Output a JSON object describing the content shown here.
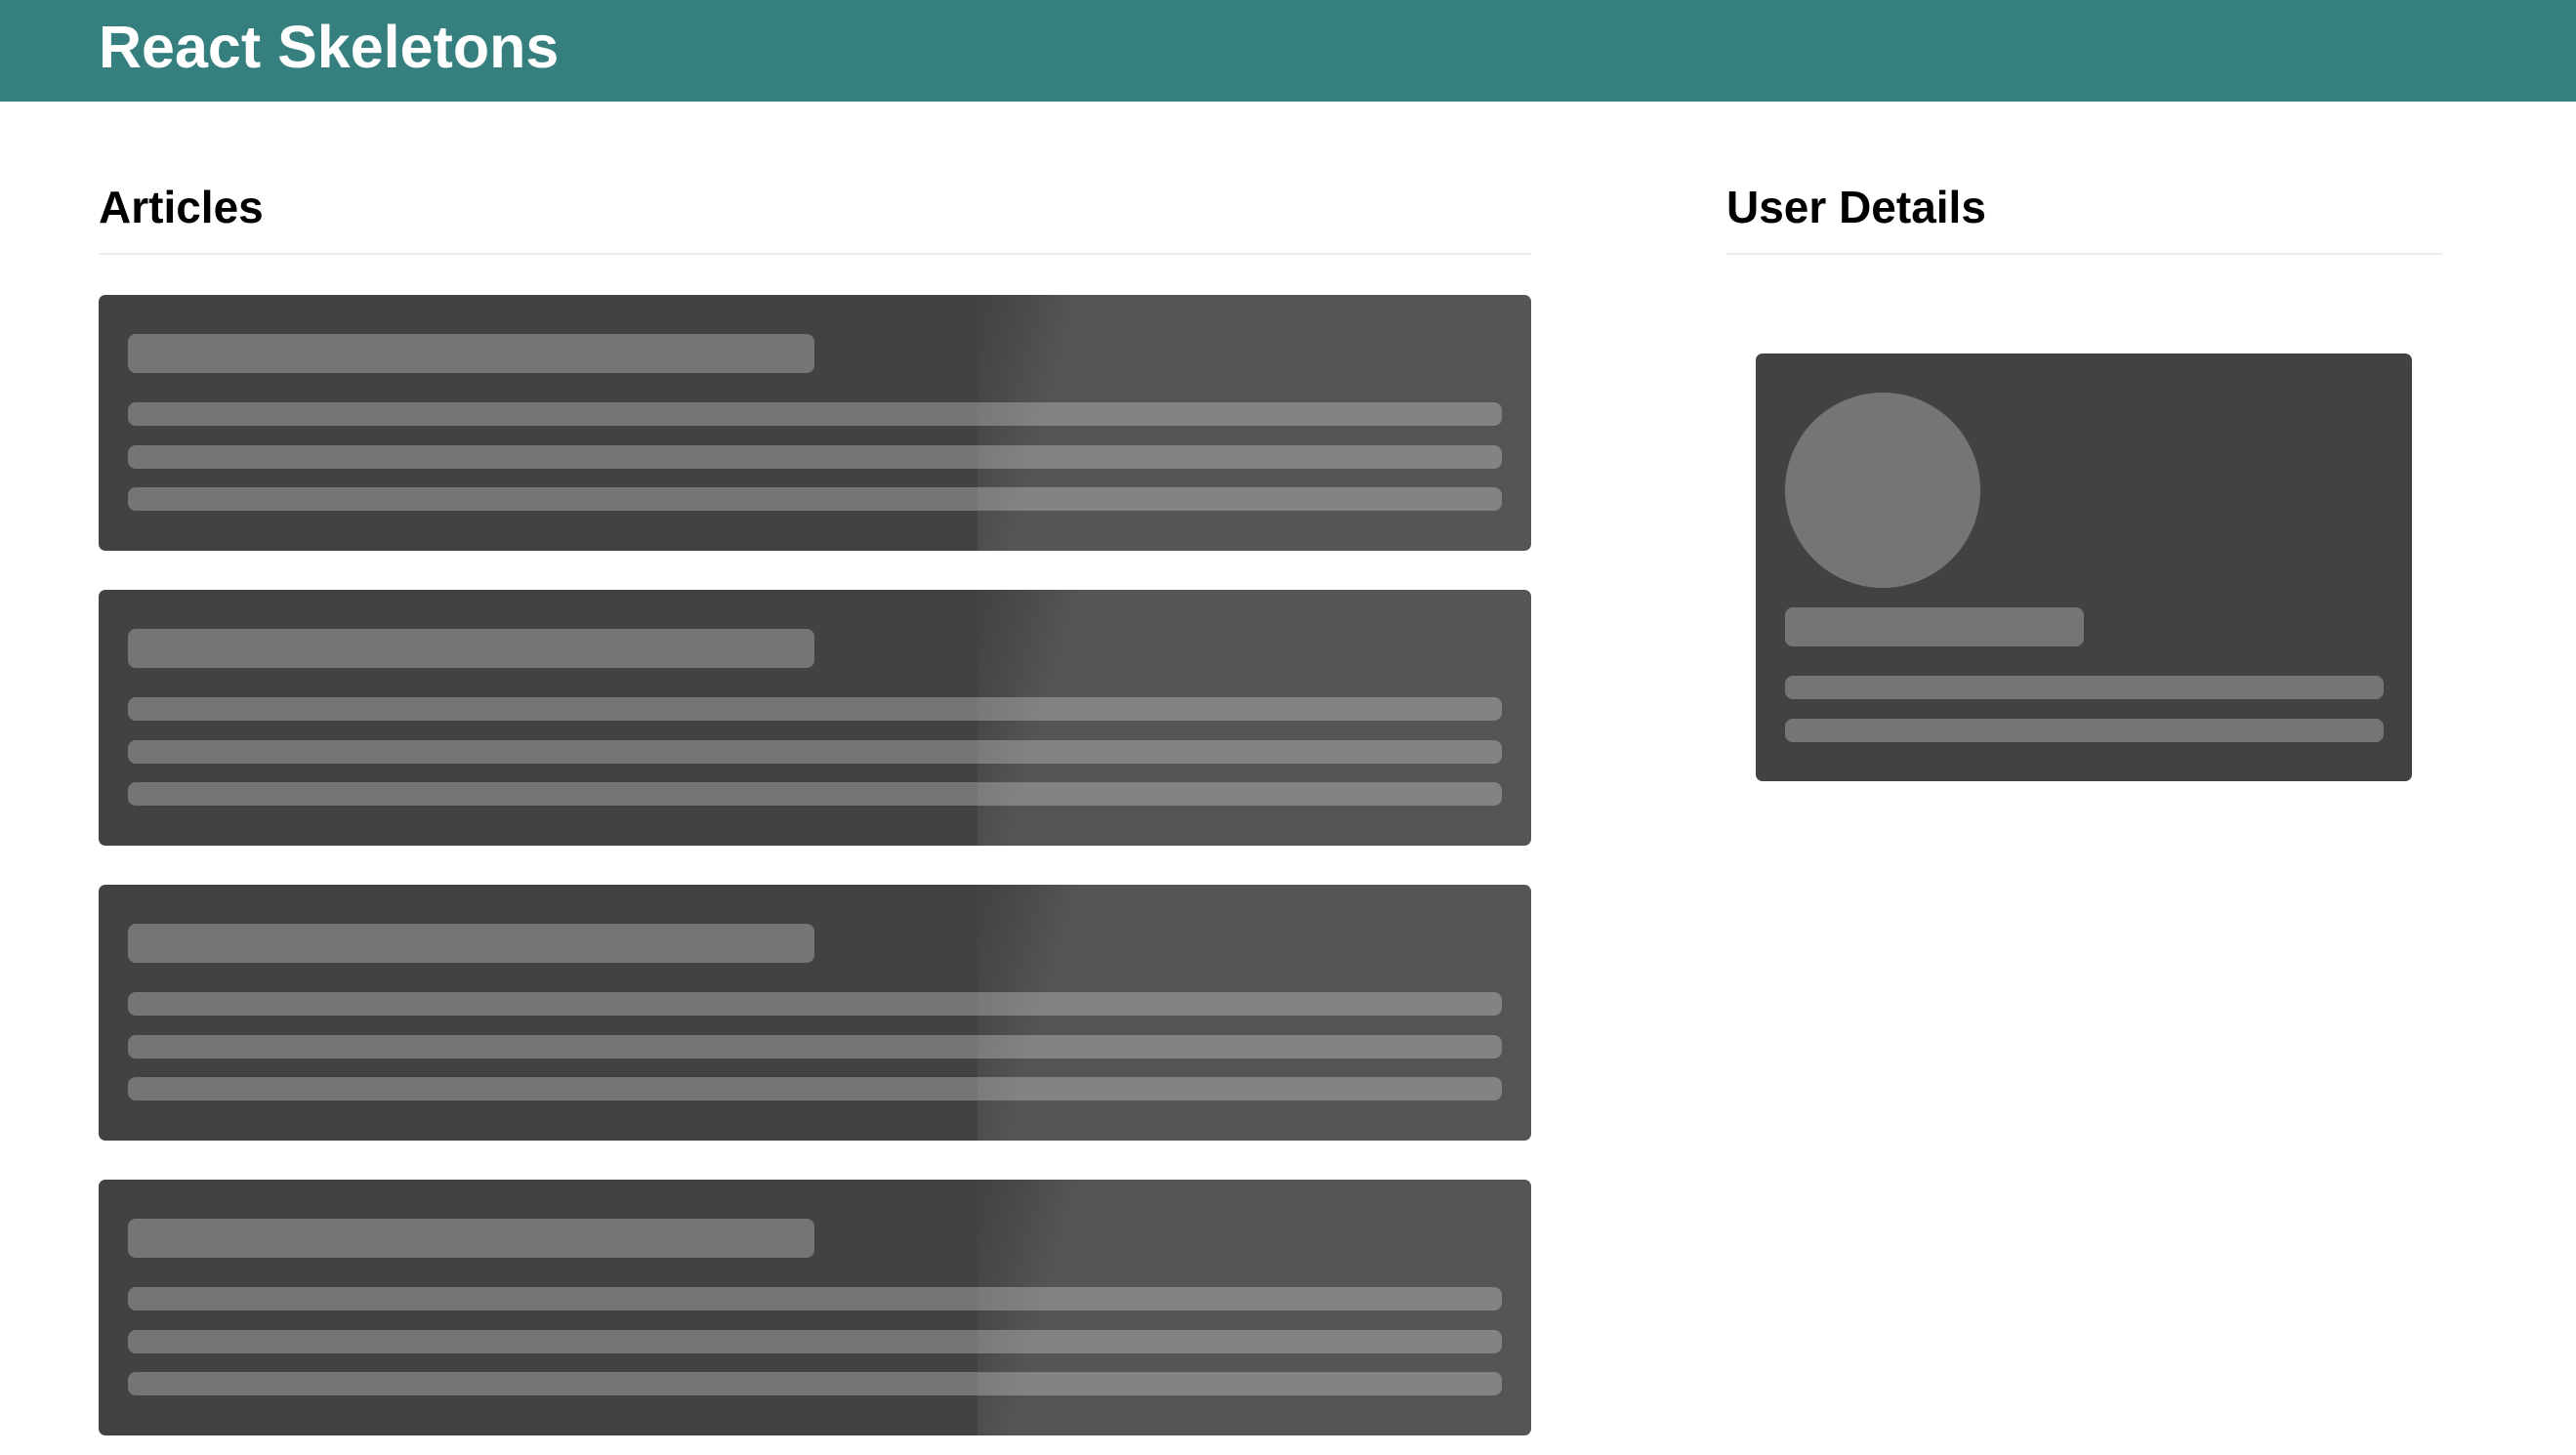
{
  "app": {
    "title": "React Skeletons",
    "header_color": "#367f7f"
  },
  "articles": {
    "heading": "Articles",
    "skeleton_count": 4
  },
  "user_details": {
    "heading": "User Details"
  },
  "colors": {
    "skeleton_background": "#424242",
    "skeleton_placeholder": "#757575",
    "page_background": "#ffffff"
  }
}
